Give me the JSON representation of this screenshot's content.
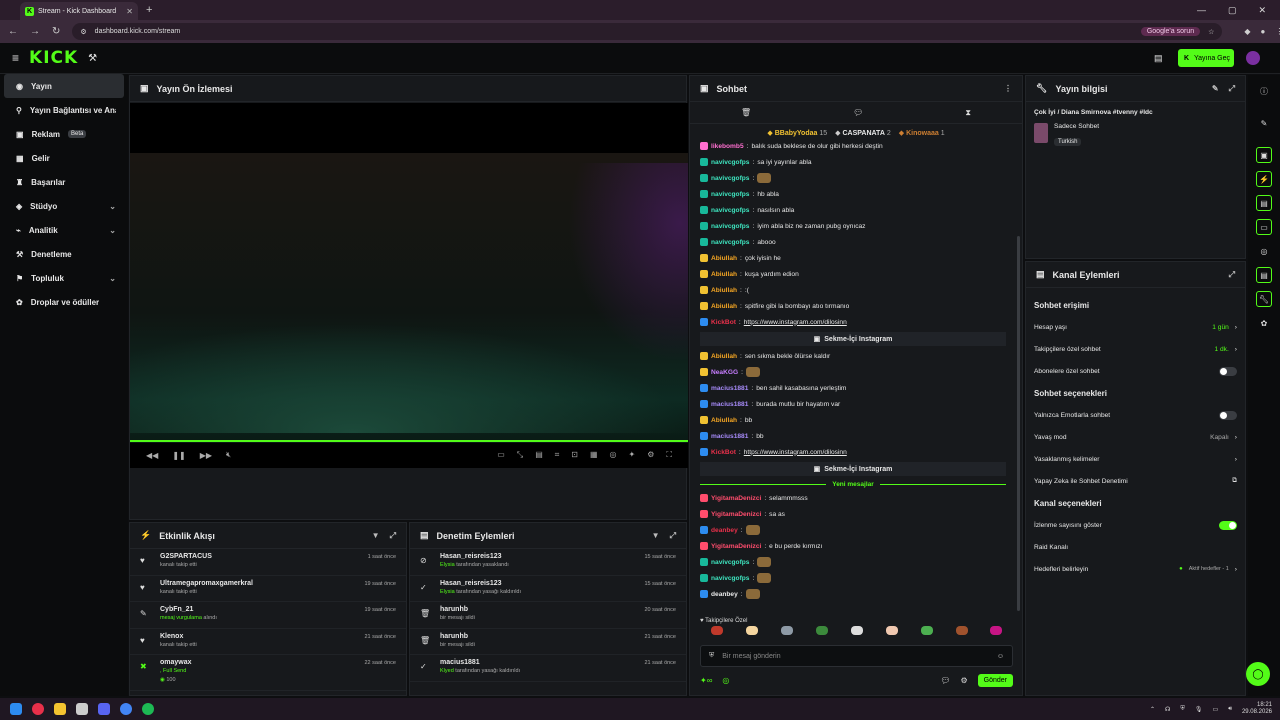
{
  "browser": {
    "tab_title": "Stream - Kick Dashboard",
    "url": "dashboard.kick.com/stream",
    "google_pill": "Google'a sorun"
  },
  "header": {
    "logo": "KICK",
    "go_live": "Yayına Geç"
  },
  "sidebar": {
    "items": [
      {
        "label": "Yayın",
        "icon": "play-icon"
      },
      {
        "label": "Yayın Bağlantısı ve Anahtarı",
        "icon": "link-icon"
      },
      {
        "label": "Reklam",
        "icon": "ad-icon",
        "badge": "Beta"
      },
      {
        "label": "Gelir",
        "icon": "revenue-icon"
      },
      {
        "label": "Başarılar",
        "icon": "trophy-icon"
      },
      {
        "label": "Stüdyo",
        "icon": "studio-icon"
      },
      {
        "label": "Analitik",
        "icon": "analytics-icon"
      },
      {
        "label": "Denetleme",
        "icon": "moderation-icon"
      },
      {
        "label": "Topluluk",
        "icon": "community-icon"
      },
      {
        "label": "Droplar ve ödüller",
        "icon": "drops-icon"
      }
    ]
  },
  "preview": {
    "title": "Yayın Ön İzlemesi"
  },
  "activity": {
    "title": "Etkinlik Akışı",
    "rows": [
      {
        "user": "G2SPARTACUS",
        "sub": "kanalı takip etti",
        "time": "1 saat önce"
      },
      {
        "user": "Ultramegapromaxgamerkral",
        "sub": "kanalı takip etti",
        "time": "19 saat önce"
      },
      {
        "user": "CybFn_21",
        "sub_green": "mesaj vurgulama",
        "sub": "alındı",
        "time": "19 saat önce"
      },
      {
        "user": "Klenox",
        "sub": "kanalı takip etti",
        "time": "21 saat önce"
      },
      {
        "user": "omaywax",
        "sub_green": ", Full Send",
        "sub": "100",
        "time": "22 saat önce"
      }
    ]
  },
  "modlog": {
    "title": "Denetim Eylemleri",
    "rows": [
      {
        "user": "Hasan_reisreis123",
        "by": "Elysia",
        "sub": "tarafından yasaklandı",
        "time": "15 saat önce"
      },
      {
        "user": "Hasan_reisreis123",
        "by": "Elysia",
        "sub": "tarafından yasağı kaldırıldı",
        "time": "15 saat önce"
      },
      {
        "user": "harunhb",
        "by": "",
        "sub": "bir mesajı sildi",
        "time": "20 saat önce"
      },
      {
        "user": "harunhb",
        "by": "",
        "sub": "bir mesajı sildi",
        "time": "21 saat önce"
      },
      {
        "user": "macius1881",
        "by": "Klyed",
        "sub": "tarafından yasağı kaldırıldı",
        "time": "21 saat önce"
      }
    ]
  },
  "chat": {
    "title": "Sohbet",
    "leaders": [
      {
        "name": "BBabyYodaa",
        "count": "15"
      },
      {
        "name": "CASPANATA",
        "count": "2"
      },
      {
        "name": "Kinowaaa",
        "count": "1"
      }
    ],
    "messages": [
      {
        "user": "likebomb5",
        "text": "balık suda beklese de olur gibi herkesi deştin",
        "color": "#ff6fd0"
      },
      {
        "user": "navivcgofps",
        "text": "sa iyi yayınlar abla",
        "color": "#3ee6c0"
      },
      {
        "user": "navivcgofps",
        "text": "",
        "color": "#3ee6c0"
      },
      {
        "user": "navivcgofps",
        "text": "hb abla",
        "color": "#3ee6c0"
      },
      {
        "user": "navivcgofps",
        "text": "nasılsın abla",
        "color": "#3ee6c0"
      },
      {
        "user": "navivcgofps",
        "text": "iyim abla biz ne zaman pubg oynıcaz",
        "color": "#3ee6c0"
      },
      {
        "user": "navivcgofps",
        "text": "abooo",
        "color": "#3ee6c0"
      },
      {
        "user": "Abiullah",
        "text": "çok iyisin he",
        "color": "#f5a623"
      },
      {
        "user": "Abiullah",
        "text": "kuşa yardım edion",
        "color": "#f5a623"
      },
      {
        "user": "Abiullah",
        "text": ":(",
        "color": "#f5a623"
      },
      {
        "user": "Abiullah",
        "text": "spitfire gibi la bombayı atıo tırmanıo",
        "color": "#f5a623"
      },
      {
        "user": "KickBot",
        "text": "https://www.instagram.com/dilosinn",
        "color": "#e8304a",
        "link": true
      },
      {
        "pin": "Sekme-İçi Instagram"
      },
      {
        "user": "Abiullah",
        "text": "sen sıkma bekle ölürse kaldır",
        "color": "#f5a623"
      },
      {
        "user": "NeaKGG",
        "text": "",
        "color": "#c77dff"
      },
      {
        "user": "macius1881",
        "text": "ben sahil kasabasına yerleştim",
        "color": "#a78bfa"
      },
      {
        "user": "macius1881",
        "text": "burada mutlu bir hayatım var",
        "color": "#a78bfa"
      },
      {
        "user": "Abiullah",
        "text": "bb",
        "color": "#f5a623"
      },
      {
        "user": "macius1881",
        "text": "bb",
        "color": "#a78bfa"
      },
      {
        "user": "KickBot",
        "text": "https://www.instagram.com/dilosinn",
        "color": "#e8304a",
        "link": true
      },
      {
        "pin": "Sekme-İçi Instagram"
      },
      {
        "divider": "Yeni mesajlar"
      },
      {
        "user": "YigitamaDenizci",
        "text": "selammmsss",
        "color": "#ff4d6d"
      },
      {
        "user": "YigitamaDenizci",
        "text": "sa as",
        "color": "#ff4d6d"
      },
      {
        "user": "deanbey",
        "text": "",
        "color": "#e8304a"
      },
      {
        "user": "YigitamaDenizci",
        "text": "e bu perde kırmızı",
        "color": "#ff4d6d"
      },
      {
        "user": "navivcgofps",
        "text": "",
        "color": "#3ee6c0"
      },
      {
        "user": "navivcgofps",
        "text": "",
        "color": "#3ee6c0"
      },
      {
        "user": "deanbey",
        "text": "",
        "color": "#e8e8e8"
      }
    ],
    "emote_label": "Takipçilere Özel",
    "input_placeholder": "Bir mesaj gönderin",
    "send_label": "Gönder"
  },
  "stream_info": {
    "title": "Yayın bilgisi",
    "stream_title": "Çok İyi / Diana Smirnova #tvenny #ldc",
    "category": "Sadece Sohbet",
    "language": "Turkish"
  },
  "channel_actions": {
    "title": "Kanal Eylemleri",
    "chat_access": "Sohbet erişimi",
    "account_age": {
      "label": "Hesap yaşı",
      "value": "1 gün"
    },
    "followers_only": {
      "label": "Takipçilere özel sohbet",
      "value": "1 dk."
    },
    "subscribers_only": {
      "label": "Abonelere özel sohbet"
    },
    "chat_options": "Sohbet seçenekleri",
    "emote_only": {
      "label": "Yalnızca Emotlarla sohbet"
    },
    "slow_mode": {
      "label": "Yavaş mod",
      "value": "Kapalı"
    },
    "banned_words": {
      "label": "Yasaklanmış kelimeler"
    },
    "ai_mod": {
      "label": "Yapay Zeka ile Sohbet Denetimi"
    },
    "channel_options": "Kanal seçenekleri",
    "show_viewers": {
      "label": "İzlenme sayısını göster"
    },
    "raid": {
      "label": "Raid Kanalı"
    },
    "goals": {
      "label": "Hedefleri belirleyin",
      "value": "Aktif hedefler - 1"
    }
  },
  "taskbar": {
    "time": "18:21",
    "date": "29.08.2026"
  }
}
